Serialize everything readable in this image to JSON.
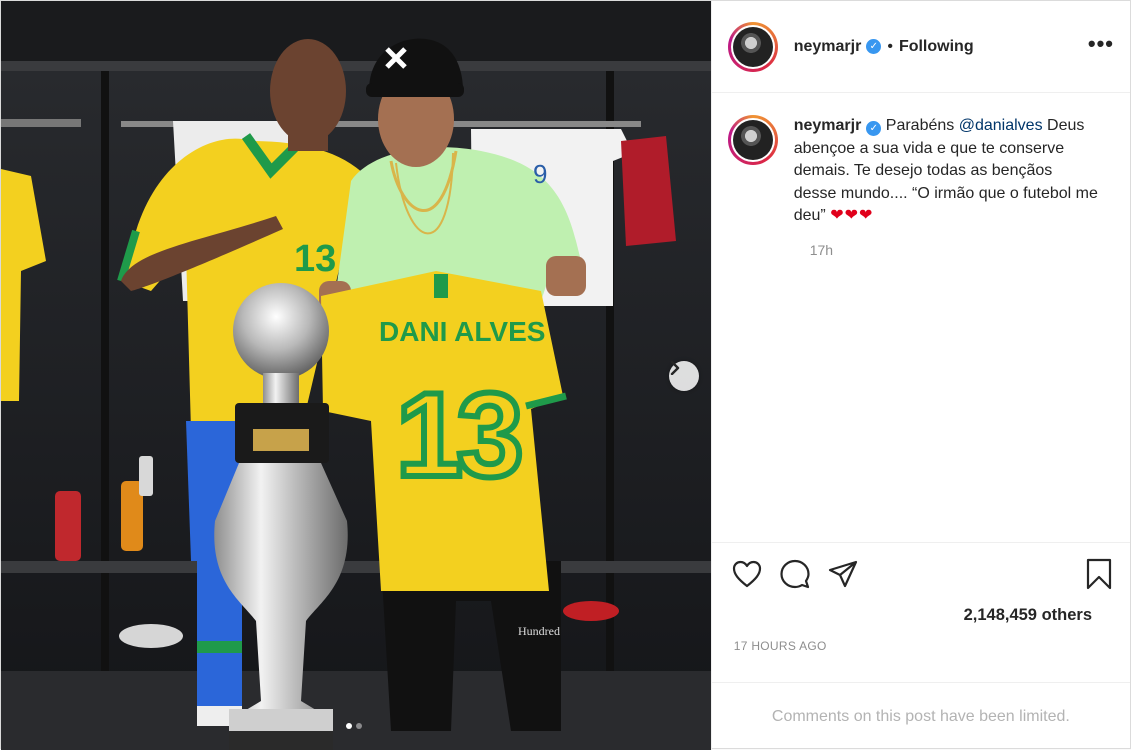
{
  "post": {
    "username": "neymarjr",
    "follow_separator": "•",
    "follow_status": "Following",
    "more_label": "•••",
    "caption": {
      "username": "neymarjr",
      "text_prefix": "Parabéns",
      "mention": "@danialves",
      "text_body": "Deus abençoe a sua vida e que te conserve demais. Te desejo todas as bençãos desse mundo.... “O irmão que o futebol me deu”",
      "emoji": "❤❤❤"
    },
    "comment_time": "17h",
    "likes_text": "2,148,459 others",
    "timestamp": "17 HOURS AGO",
    "comments_notice": "Comments on this post have been limited."
  },
  "media": {
    "jersey_name": "DANI ALVES",
    "jersey_number": "13",
    "left_shirt_number": "13",
    "back_shirt_number": "9",
    "brand_text": "Hundred",
    "carousel_dots": 2,
    "active_dot": 1
  },
  "colors": {
    "jersey_yellow": "#f3d01f",
    "jersey_green": "#1f9a4a",
    "accent_blue": "#3897f0",
    "heart_red": "#e0001b"
  },
  "icons": [
    "heart-icon",
    "comment-icon",
    "share-icon",
    "bookmark-icon",
    "chevron-right-icon",
    "verified-icon",
    "more-icon"
  ]
}
